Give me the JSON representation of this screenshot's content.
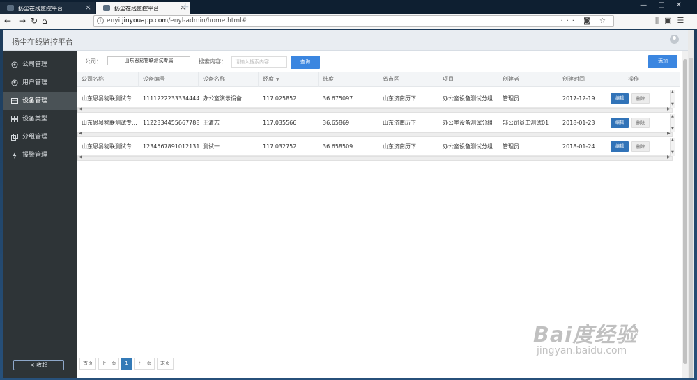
{
  "browser": {
    "tabs": [
      {
        "title": "扬尘在线监控平台",
        "active": false
      },
      {
        "title": "扬尘在线监控平台",
        "active": true
      }
    ],
    "url_prefix": "enyi.",
    "url_domain": "jinyouapp.com",
    "url_path": "/enyl-admin/home.html#"
  },
  "app": {
    "title": "扬尘在线监控平台"
  },
  "sidebar": {
    "items": [
      {
        "label": "公司管理",
        "icon": "company-icon",
        "active": false
      },
      {
        "label": "用户管理",
        "icon": "user-icon",
        "active": false
      },
      {
        "label": "设备管理",
        "icon": "device-icon",
        "active": true
      },
      {
        "label": "设备类型",
        "icon": "device-type-icon",
        "active": false
      },
      {
        "label": "分组管理",
        "icon": "group-icon",
        "active": false
      },
      {
        "label": "报警管理",
        "icon": "alarm-icon",
        "active": false
      }
    ],
    "collapse_label": "< 收起"
  },
  "filter": {
    "company_label": "公司：",
    "company_value": "山东恩易物联测试专属",
    "search_label": "搜索内容：",
    "search_placeholder": "请输入搜索内容",
    "query_label": "查询",
    "add_label": "添加"
  },
  "table": {
    "columns": [
      "公司名称",
      "设备编号",
      "设备名称",
      "经度",
      "纬度",
      "省市区",
      "项目",
      "创建者",
      "创建时间",
      "操作"
    ],
    "edit_label": "编辑",
    "delete_label": "删除",
    "rows": [
      [
        "山东恩易物联测试专...",
        "1111222233334444",
        "办公室演示设备",
        "117.025852",
        "36.675097",
        "山东济南历下",
        "办公室设备测试分组",
        "管理员",
        "2017-12-19"
      ],
      [
        "山东恩易物联测试专...",
        "1122334455667788",
        "王清志",
        "117.035566",
        "36.65869",
        "山东济南历下",
        "办公室设备测试分组",
        "部公司员工测试01",
        "2018-01-23"
      ],
      [
        "山东恩易物联测试专...",
        "1234567891012131",
        "测试一",
        "117.032752",
        "36.658509",
        "山东济南历下",
        "办公室设备测试分组",
        "管理员",
        "2018-01-24"
      ]
    ]
  },
  "pager": {
    "first": "首页",
    "prev": "上一页",
    "current": "1",
    "next": "下一页",
    "last": "末页"
  },
  "watermark": {
    "main": "Bai度经验",
    "sub": "jingyan.baidu.com"
  },
  "colors": {
    "accent": "#3b86e0",
    "sidebar": "#2e3437",
    "edit": "#3173b8"
  }
}
